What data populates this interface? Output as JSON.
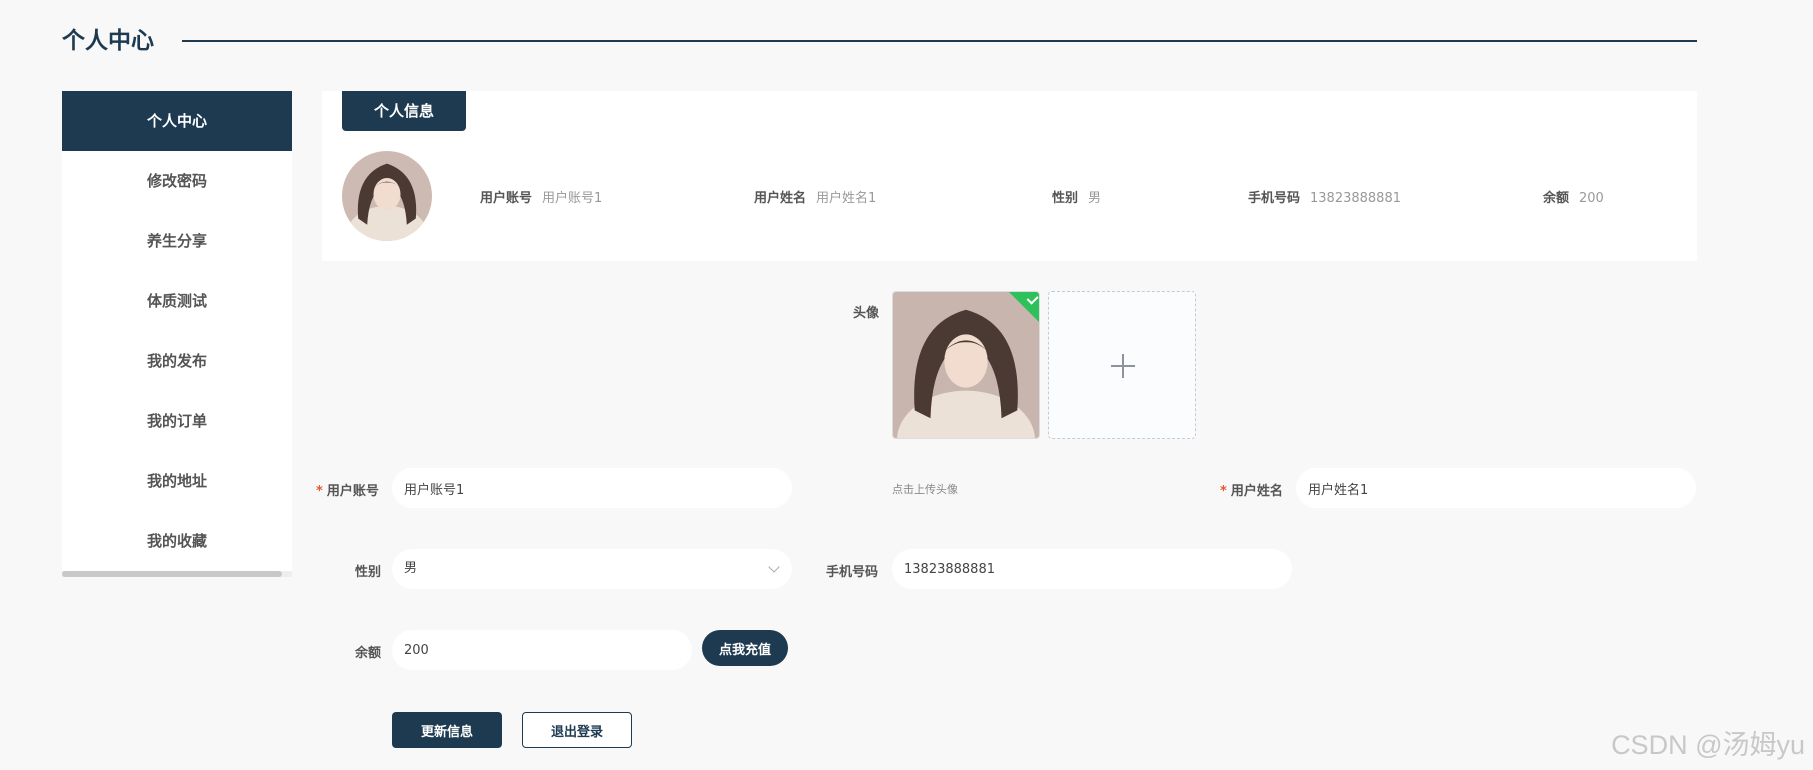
{
  "page": {
    "title": "个人中心"
  },
  "sidebar": {
    "items": [
      {
        "label": "个人中心",
        "active": true
      },
      {
        "label": "修改密码"
      },
      {
        "label": "养生分享"
      },
      {
        "label": "体质测试"
      },
      {
        "label": "我的发布"
      },
      {
        "label": "我的订单"
      },
      {
        "label": "我的地址"
      },
      {
        "label": "我的收藏"
      }
    ]
  },
  "info_card": {
    "tab_label": "个人信息",
    "fields": [
      {
        "label": "用户账号",
        "value": "用户账号1"
      },
      {
        "label": "用户姓名",
        "value": "用户姓名1"
      },
      {
        "label": "性别",
        "value": "男"
      },
      {
        "label": "手机号码",
        "value": "13823888881"
      },
      {
        "label": "余额",
        "value": "200"
      }
    ]
  },
  "form": {
    "avatar_label": "头像",
    "upload_hint": "点击上传头像",
    "account_label": "用户账号",
    "account_value": "用户账号1",
    "name_label": "用户姓名",
    "name_value": "用户姓名1",
    "gender_label": "性别",
    "gender_value": "男",
    "phone_label": "手机号码",
    "phone_value": "13823888881",
    "balance_label": "余额",
    "balance_value": "200",
    "recharge_label": "点我充值",
    "update_label": "更新信息",
    "logout_label": "退出登录",
    "required_mark": "*"
  },
  "icons": {
    "upload_add": "plus-icon",
    "select_arrow": "chevron-down-icon",
    "upload_success": "check-icon"
  },
  "colors": {
    "primary": "#1d3a50",
    "success": "#2ec05a",
    "required": "#e4572e"
  },
  "watermark": "CSDN @汤姆yu"
}
